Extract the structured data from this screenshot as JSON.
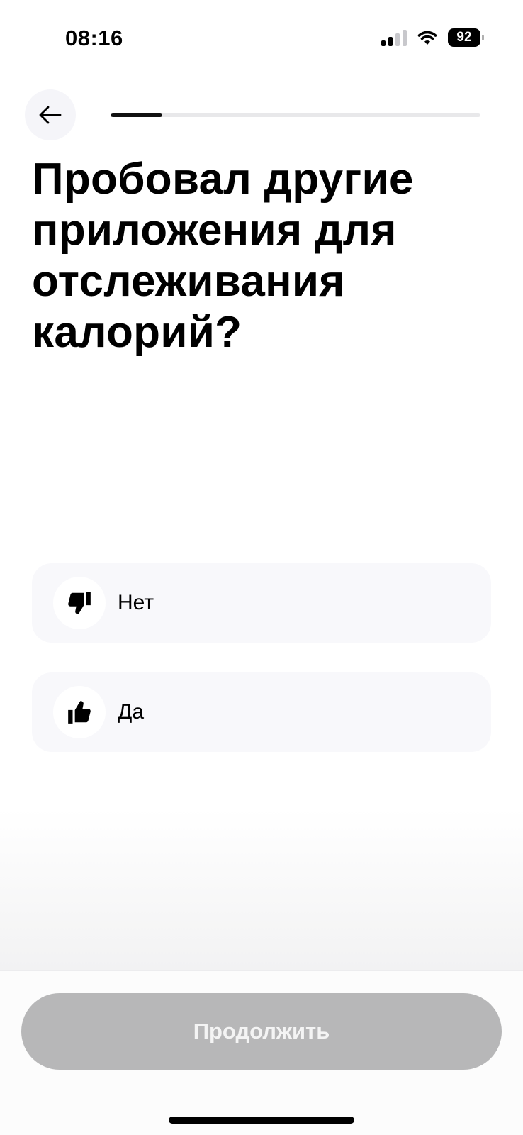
{
  "status_bar": {
    "time": "08:16",
    "signal_bars": 4,
    "signal_active": 2,
    "wifi_icon": "wifi-icon",
    "battery": "92"
  },
  "header": {
    "back_icon": "arrow-left-icon",
    "progress": 0.14
  },
  "question": {
    "title": "Пробовал другие приложения для отслеживания калорий?"
  },
  "options": [
    {
      "label": "Нет",
      "icon": "thumbs-down-icon"
    },
    {
      "label": "Да",
      "icon": "thumbs-up-icon"
    }
  ],
  "footer": {
    "continue_label": "Продолжить",
    "continue_enabled": false
  },
  "colors": {
    "background": "#ffffff",
    "option_background": "#f8f8fb",
    "progress_fill": "#111111",
    "progress_track": "#e8e8ea",
    "button_disabled": "#b7b7b8"
  }
}
